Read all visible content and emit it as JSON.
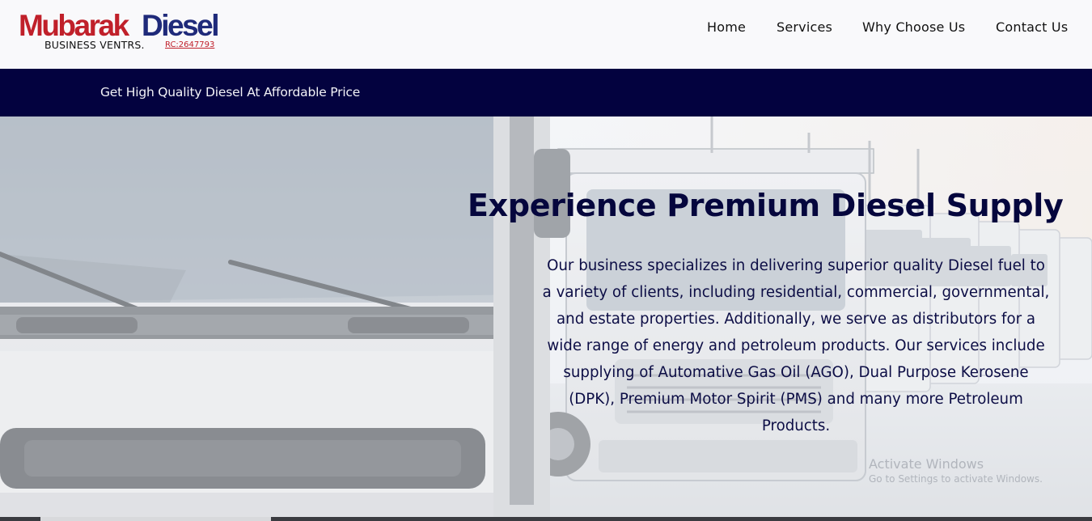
{
  "brand": {
    "name_part1": "Mubarak",
    "name_part2": "Diesel",
    "subtitle": "BUSINESS VENTRS.",
    "rc_number": "RC:2647793",
    "color_primary": "#c0202a",
    "color_secondary": "#1f2a7a"
  },
  "nav": {
    "items": [
      {
        "label": "Home"
      },
      {
        "label": "Services"
      },
      {
        "label": "Why Choose Us"
      },
      {
        "label": "Contact Us"
      }
    ]
  },
  "banner": {
    "text": "Get High Quality Diesel At Affordable Price",
    "background": "#03023f"
  },
  "hero": {
    "title": "Experience Premium Diesel Supply",
    "body": "Our business specializes in delivering superior quality Diesel fuel to a variety of clients, including residential, commercial, governmental, and estate properties. Additionally, we serve as distributors for a wide range of energy and petroleum products. Our services include supplying of Automative Gas Oil (AGO), Dual Purpose Kerosene (DPK), Premium Motor Spirit (PMS) and many more Petroleum Products.",
    "image_subject": "fleet of white trucks"
  },
  "os_watermark": {
    "line1": "Activate Windows",
    "line2": "Go to Settings to activate Windows."
  }
}
